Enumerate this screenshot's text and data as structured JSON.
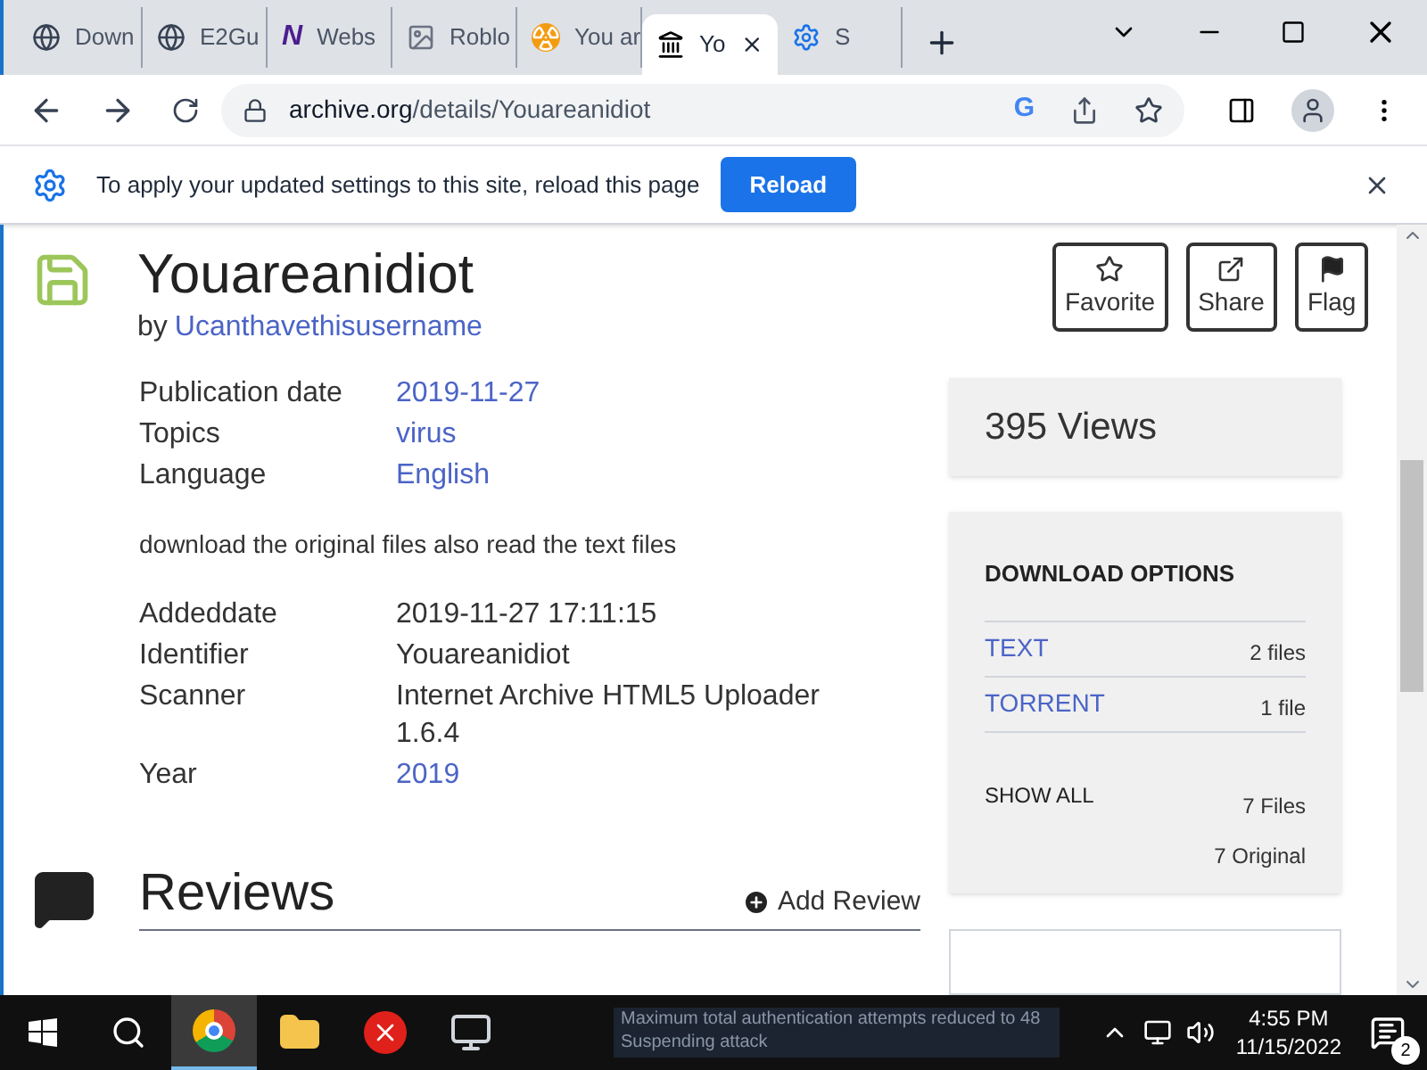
{
  "tabs": [
    {
      "title": "Down",
      "kind": "globe",
      "selected": false
    },
    {
      "title": "E2Gu",
      "kind": "globe",
      "selected": false
    },
    {
      "title": "Webs",
      "kind": "letter",
      "letter": "N",
      "selected": false
    },
    {
      "title": "Roblo",
      "kind": "image",
      "selected": false
    },
    {
      "title": "You ar",
      "kind": "hazard",
      "selected": false
    },
    {
      "title": "Yo",
      "kind": "archive",
      "selected": true
    },
    {
      "title": "S",
      "kind": "gear",
      "selected": false
    }
  ],
  "address": {
    "host": "archive.org",
    "path": "/details/Youareanidiot",
    "google_letter": "G"
  },
  "infobar": {
    "message": "To apply your updated settings to this site, reload this page",
    "button": "Reload"
  },
  "item": {
    "title": "Youareanidiot",
    "by": "by",
    "author": "Ucanthavethisusername",
    "actions": [
      {
        "label": "Favorite",
        "kind": "star"
      },
      {
        "label": "Share",
        "kind": "share"
      },
      {
        "label": "Flag",
        "kind": "flag"
      }
    ],
    "meta": [
      {
        "key": "Publication date",
        "value": "2019-11-27",
        "link": true
      },
      {
        "key": "Topics",
        "value": "virus",
        "link": true
      },
      {
        "key": "Language",
        "value": "English",
        "link": true
      }
    ],
    "description": "download the original files also read the text files",
    "meta2": [
      {
        "key": "Addeddate",
        "value": "2019-11-27 17:11:15",
        "link": false
      },
      {
        "key": "Identifier",
        "value": "Youareanidiot",
        "link": false
      },
      {
        "key": "Scanner",
        "value": "Internet Archive HTML5 Uploader 1.6.4",
        "link": false
      },
      {
        "key": "Year",
        "value": "2019",
        "link": true
      }
    ]
  },
  "views": "395 Views",
  "downloads": {
    "title": "DOWNLOAD OPTIONS",
    "rows": [
      {
        "format": "TEXT",
        "count": "2 files"
      },
      {
        "format": "TORRENT",
        "count": "1 file"
      }
    ],
    "show_all": "SHOW ALL",
    "files": "7 Files",
    "original": "7 Original"
  },
  "reviews": {
    "title": "Reviews",
    "add": "Add Review"
  },
  "taskbar": {
    "notification": "Maximum total authentication attempts reduced to 48",
    "notification_2": "Suspending attack",
    "time": "4:55 PM",
    "date": "11/15/2022",
    "badge": "2"
  }
}
